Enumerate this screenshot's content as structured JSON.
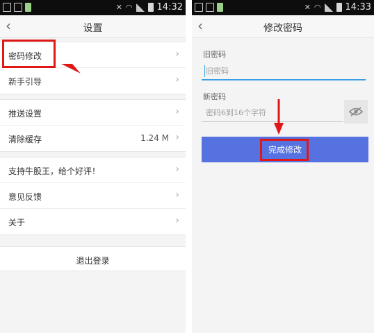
{
  "left_screen": {
    "status": {
      "time": "14:32"
    },
    "title": "设置",
    "groups": [
      [
        {
          "label": "密码修改"
        },
        {
          "label": "新手引导"
        }
      ],
      [
        {
          "label": "推送设置"
        },
        {
          "label": "清除缓存",
          "value": "1.24 M"
        }
      ],
      [
        {
          "label": "支持牛股王，给个好评！"
        },
        {
          "label": "意见反馈"
        },
        {
          "label": "关于"
        }
      ]
    ],
    "logout_label": "退出登录"
  },
  "right_screen": {
    "status": {
      "time": "14:33"
    },
    "title": "修改密码",
    "old_password": {
      "label": "旧密码",
      "placeholder": "旧密码",
      "value": ""
    },
    "new_password": {
      "label": "新密码",
      "placeholder": "密码6到16个字符",
      "value": ""
    },
    "submit_label": "完成修改"
  },
  "colors": {
    "primary_button": "#5572e0",
    "highlight": "#e01717",
    "focus_underline": "#3aa0e3"
  },
  "icons": {
    "back": "chevron-left-icon",
    "row_arrow": "chevron-right-icon",
    "visibility": "eye-off-icon"
  }
}
